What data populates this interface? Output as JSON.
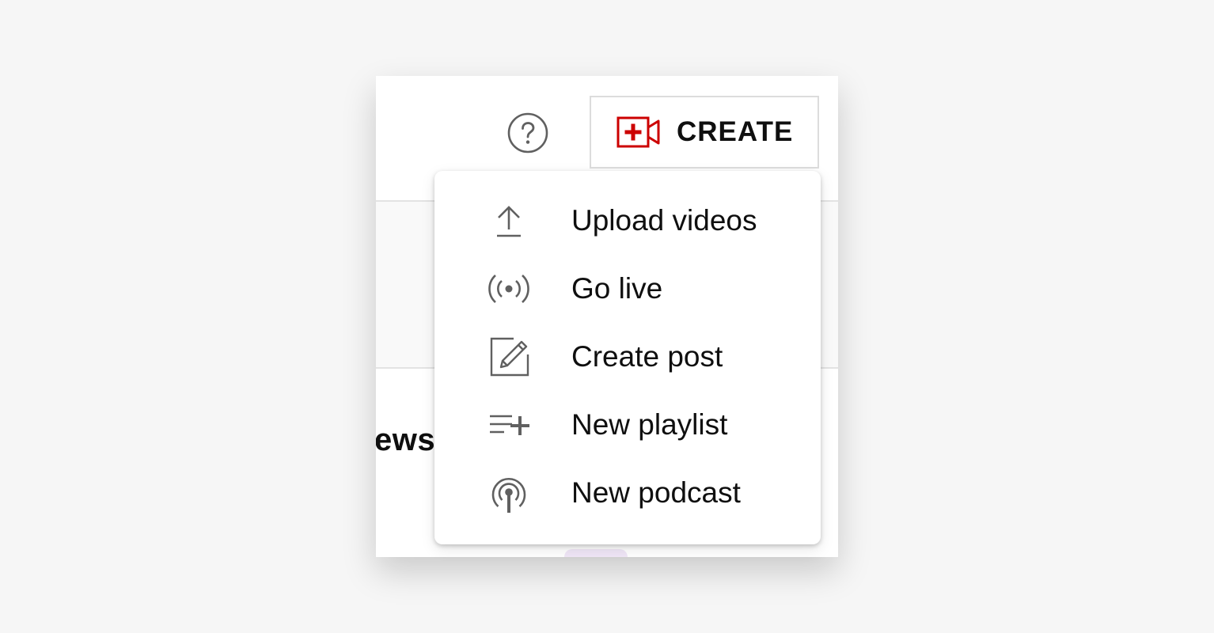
{
  "header": {
    "create_label": "CREATE"
  },
  "background": {
    "partial_heading": "ews"
  },
  "icons": {
    "help": "help-circle-icon",
    "create": "video-camera-plus-icon",
    "upload": "upload-icon",
    "live": "broadcast-icon",
    "post": "edit-post-icon",
    "playlist": "playlist-add-icon",
    "podcast": "podcast-icon"
  },
  "colors": {
    "accent_red": "#cc0000",
    "icon_gray": "#606060",
    "text": "#0f0f0f"
  },
  "create_menu": {
    "items": [
      {
        "label": "Upload videos",
        "icon": "upload-icon"
      },
      {
        "label": "Go live",
        "icon": "broadcast-icon"
      },
      {
        "label": "Create post",
        "icon": "edit-post-icon"
      },
      {
        "label": "New playlist",
        "icon": "playlist-add-icon"
      },
      {
        "label": "New podcast",
        "icon": "podcast-icon"
      }
    ]
  }
}
